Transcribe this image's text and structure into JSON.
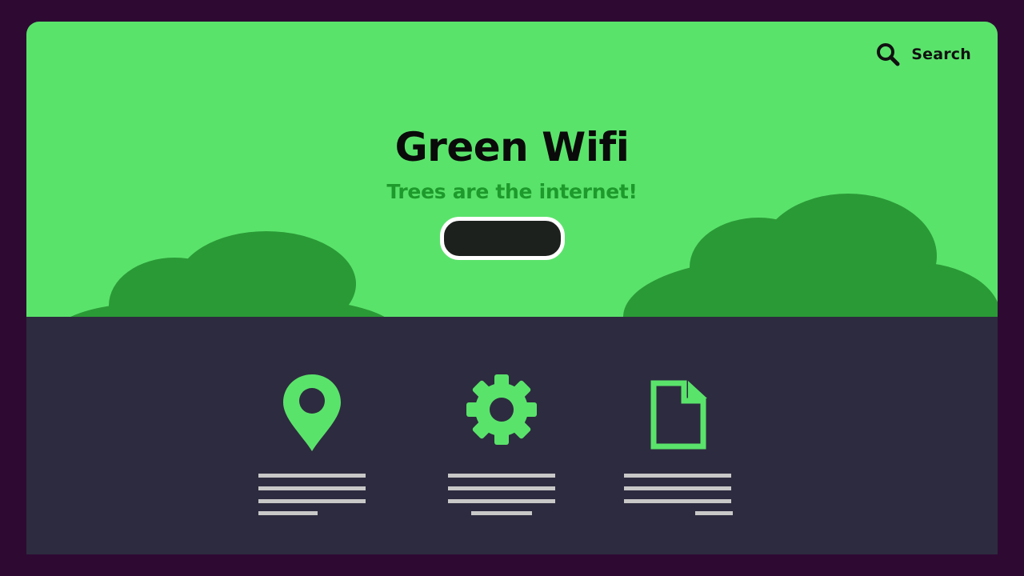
{
  "header": {
    "search_label": "Search",
    "search_icon": "search-icon"
  },
  "hero": {
    "title": "Green Wifi",
    "subtitle": "Trees are the internet!",
    "cta_label": ""
  },
  "features": [
    {
      "icon": "location-pin-icon"
    },
    {
      "icon": "gear-icon"
    },
    {
      "icon": "document-icon"
    }
  ],
  "colors": {
    "background": "#2e0a33",
    "hero": "#5ae36b",
    "bushes": "#2a9a36",
    "footer": "#2d2b3f",
    "accent": "#5ae36b",
    "subtitle": "#1d9a2b",
    "button": "#1d211d"
  }
}
